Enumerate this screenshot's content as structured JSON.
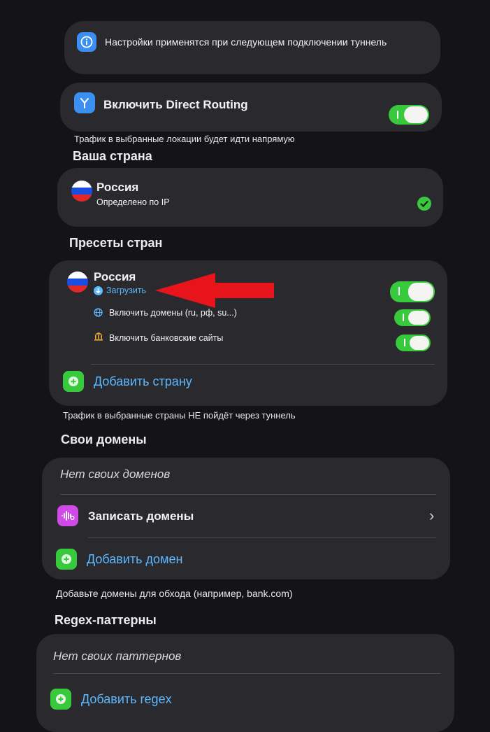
{
  "info": {
    "text": "Настройки применятся при следующем подключении туннель",
    "icon": "info-icon"
  },
  "direct_routing": {
    "label": "Включить Direct Routing",
    "enabled": true,
    "icon": "routing-fork-icon",
    "caption": "Трафик в выбранные локации будет идти напрямую"
  },
  "your_country": {
    "heading": "Ваша страна",
    "name": "Россия",
    "subtitle": "Определено по IP",
    "selected": true
  },
  "country_presets": {
    "heading": "Пресеты стран",
    "preset": {
      "name": "Россия",
      "download_label": "Загрузить",
      "enabled": true,
      "domains_label": "Включить домены (ru, рф, su...)",
      "domains_enabled": true,
      "banks_label": "Включить банковские сайты",
      "banks_enabled": true
    },
    "add_label": "Добавить страну",
    "caption": "Трафик в выбранные страны НЕ пойдёт через туннель"
  },
  "own_domains": {
    "heading": "Свои домены",
    "empty_text": "Нет своих доменов",
    "record_label": "Записать домены",
    "record_chevron": "›",
    "add_label": "Добавить домен",
    "caption": "Добавьте домены для обхода (например, bank.com)"
  },
  "regex": {
    "heading": "Regex-паттерны",
    "empty_text": "Нет своих паттернов",
    "add_label": "Добавить regex"
  },
  "colors": {
    "accent_green": "#38c93c",
    "link_blue": "#5cb8ff",
    "annotation_arrow": "#e8141c"
  }
}
